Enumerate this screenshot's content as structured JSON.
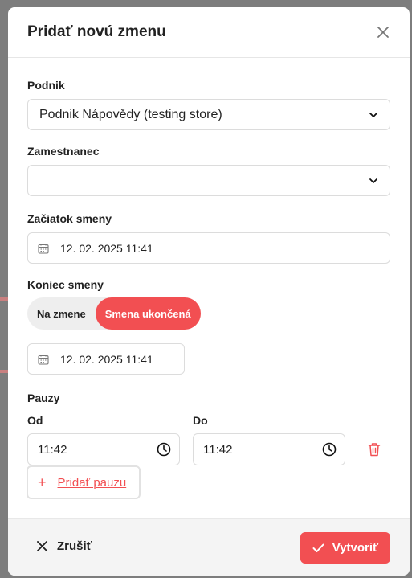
{
  "modal": {
    "title": "Pridať novú zmenu",
    "close_icon": "close-icon"
  },
  "form": {
    "store_label": "Podnik",
    "store_value": "Podnik Nápovědy (testing store)",
    "employee_label": "Zamestnanec",
    "employee_value": "",
    "start_label": "Začiatok smeny",
    "start_value": "12. 02. 2025 11:41",
    "end_label": "Koniec smeny",
    "end_toggle": {
      "option_on_shift": "Na zmene",
      "option_ended": "Smena ukončená",
      "selected": "Smena ukončená"
    },
    "end_value": "12. 02. 2025 11:41",
    "pauses_label": "Pauzy",
    "pause_from_label": "Od",
    "pause_to_label": "Do",
    "pauses": [
      {
        "from": "11:42",
        "to": "11:42"
      }
    ],
    "add_pause_label": "Pridať pauzu"
  },
  "footer": {
    "cancel_label": "Zrušiť",
    "create_label": "Vytvoriť"
  },
  "colors": {
    "accent": "#f24f52",
    "overlay": "#7d7d7d"
  }
}
